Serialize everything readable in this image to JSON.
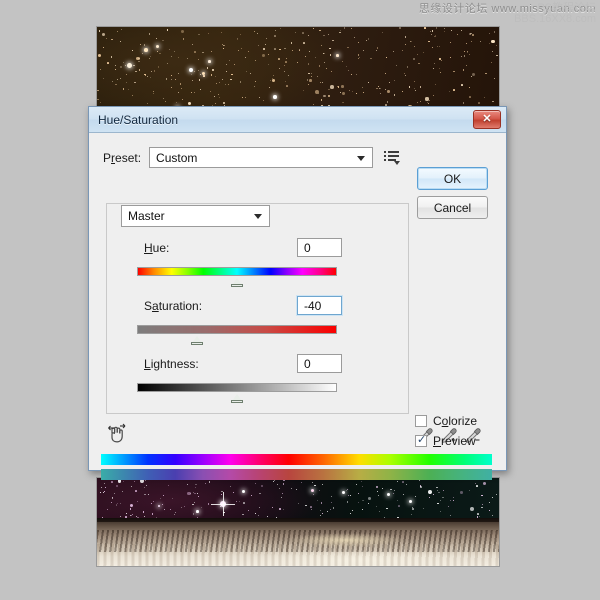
{
  "watermark": {
    "line1": "思缘设计论坛  www.missyuan.com",
    "line2": "PS教程论坛",
    "line3": "BBS.16XX8.com"
  },
  "dialog": {
    "title": "Hue/Saturation",
    "close_label": "✕",
    "preset": {
      "label": "Preset:",
      "label_prefix": "P",
      "label_accel": "r",
      "label_suffix": "eset:",
      "value": "Custom",
      "menu_icon": "preset-options-icon"
    },
    "buttons": {
      "ok": "OK",
      "cancel": "Cancel"
    },
    "channel": {
      "value": "Master"
    },
    "sliders": [
      {
        "name": "Hue:",
        "value": "0",
        "thumb_pct": 50,
        "track": "hue",
        "focused": false
      },
      {
        "name": "Saturation:",
        "value": "-40",
        "thumb_pct": 30,
        "track": "saturation",
        "focused": true
      },
      {
        "name": "Lightness:",
        "value": "0",
        "thumb_pct": 50,
        "track": "lightness",
        "focused": false
      }
    ],
    "tools": {
      "on_image_adjust": "hand-adjust-icon",
      "eyedropper": "eyedropper-icon",
      "eyedropper_add": "eyedropper-add-icon",
      "eyedropper_subtract": "eyedropper-subtract-icon"
    },
    "checkboxes": {
      "colorize": {
        "label": "Colorize",
        "checked": false
      },
      "preview": {
        "label": "Preview",
        "checked": true
      }
    },
    "colors": {
      "titlebar_start": "#dceaf6",
      "titlebar_end": "#cfe3f3",
      "close_button": "#c0402f",
      "ok_border": "#5b9fd4",
      "panel_bg": "#efefef",
      "backdrop": "#c3c3c3"
    }
  }
}
